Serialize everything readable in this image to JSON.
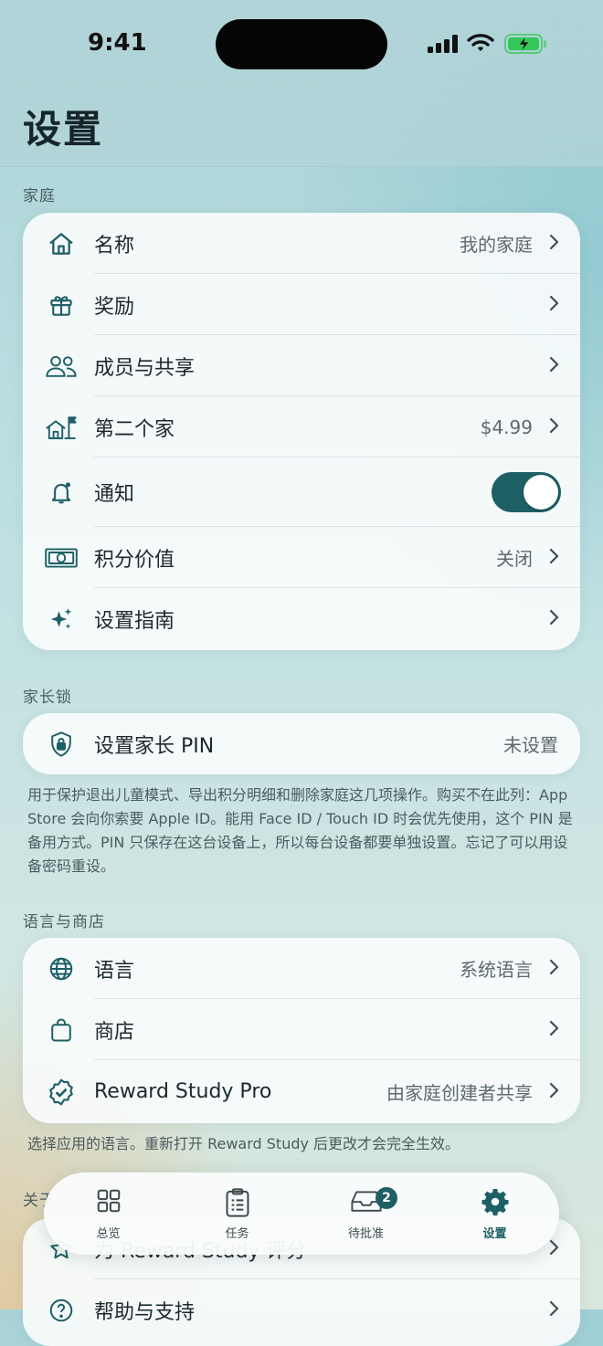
{
  "status": {
    "time": "9:41"
  },
  "header": {
    "title": "设置"
  },
  "sections": {
    "family": {
      "label": "家庭",
      "rows": {
        "name": {
          "label": "名称",
          "value": "我的家庭"
        },
        "rewards": {
          "label": "奖励"
        },
        "members": {
          "label": "成员与共享"
        },
        "second_home": {
          "label": "第二个家",
          "value": "$4.99"
        },
        "notifications": {
          "label": "通知",
          "enabled": true
        },
        "points_value": {
          "label": "积分价值",
          "value": "关闭"
        },
        "setup_guide": {
          "label": "设置指南"
        }
      }
    },
    "parent_lock": {
      "label": "家长锁",
      "rows": {
        "pin": {
          "label": "设置家长 PIN",
          "value": "未设置"
        }
      },
      "note": "用于保护退出儿童模式、导出积分明细和删除家庭这几项操作。购买不在此列：App Store 会向你索要 Apple ID。能用 Face ID / Touch ID 时会优先使用，这个 PIN 是备用方式。PIN 只保存在这台设备上，所以每台设备都要单独设置。忘记了可以用设备密码重设。"
    },
    "language_store": {
      "label": "语言与商店",
      "rows": {
        "language": {
          "label": "语言",
          "value": "系统语言"
        },
        "store": {
          "label": "商店"
        },
        "pro": {
          "label": "Reward Study Pro",
          "value": "由家庭创建者共享"
        }
      },
      "note": "选择应用的语言。重新打开 Reward Study 后更改才会完全生效。"
    },
    "about": {
      "label": "关于",
      "rows": {
        "rate": {
          "label": "为 Reward Study 评分"
        },
        "help": {
          "label": "帮助与支持"
        }
      }
    }
  },
  "tabbar": {
    "tabs": [
      {
        "label": "总览"
      },
      {
        "label": "任务"
      },
      {
        "label": "待批准",
        "badge": "2"
      },
      {
        "label": "设置",
        "active": true
      }
    ]
  },
  "colors": {
    "accent": "#1e5f66"
  }
}
